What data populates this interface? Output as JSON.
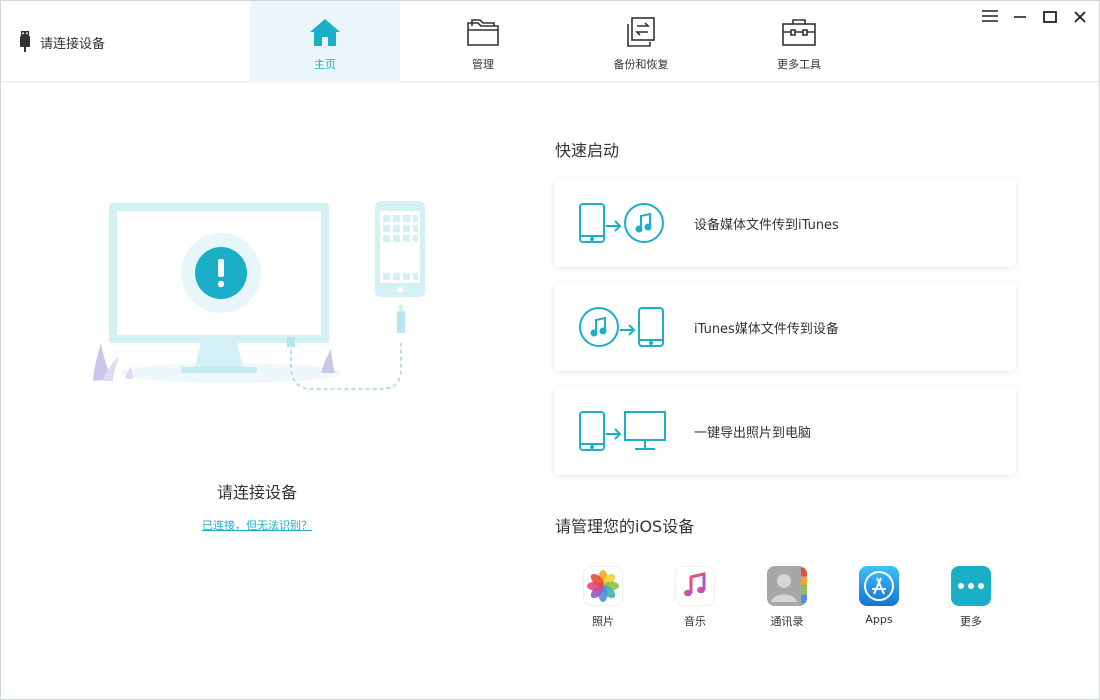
{
  "header": {
    "device_status": "请连接设备",
    "tabs": [
      {
        "label": "主页",
        "icon": "home-icon",
        "active": true
      },
      {
        "label": "管理",
        "icon": "folder-icon",
        "active": false
      },
      {
        "label": "备份和恢复",
        "icon": "backup-restore-icon",
        "active": false
      },
      {
        "label": "更多工具",
        "icon": "toolbox-icon",
        "active": false
      }
    ],
    "window_controls": [
      "menu-icon",
      "minimize-icon",
      "maximize-icon",
      "close-icon"
    ]
  },
  "left": {
    "title": "请连接设备",
    "help_link": "已连接，但无法识别？"
  },
  "quick_start": {
    "title": "快速启动",
    "items": [
      {
        "label": "设备媒体文件传到iTunes",
        "icons": [
          "phone-icon",
          "arrow-right-icon",
          "music-note-icon"
        ]
      },
      {
        "label": "iTunes媒体文件传到设备",
        "icons": [
          "music-note-icon",
          "arrow-right-icon",
          "phone-icon"
        ]
      },
      {
        "label": "一键导出照片到电脑",
        "icons": [
          "phone-icon",
          "arrow-right-icon",
          "monitor-icon"
        ]
      }
    ]
  },
  "manage": {
    "title": "请管理您的iOS设备",
    "apps": [
      {
        "label": "照片",
        "icon": "photos-icon"
      },
      {
        "label": "音乐",
        "icon": "music-icon"
      },
      {
        "label": "通讯录",
        "icon": "contacts-icon"
      },
      {
        "label": "Apps",
        "icon": "app-store-icon"
      },
      {
        "label": "更多",
        "icon": "more-icon"
      }
    ]
  },
  "colors": {
    "accent": "#1aaec7",
    "active_tab_bg": "#eaf6f9",
    "illustration_light": "#d3f0f5"
  }
}
